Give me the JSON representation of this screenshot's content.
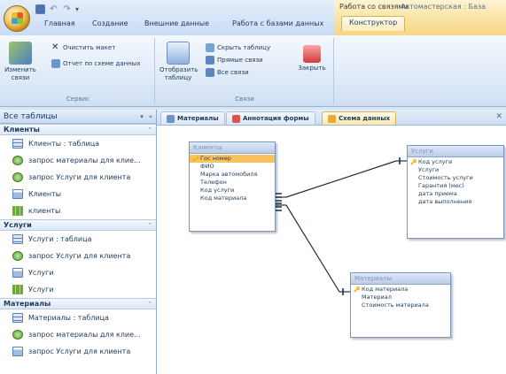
{
  "titlebar": {
    "context_group": "Работа со связями",
    "app_title": "Автомастерская : База",
    "tabs": [
      "Главная",
      "Создание",
      "Внешние данные",
      "Работа с базами данных",
      "Конструктор"
    ],
    "active_tab": "Конструктор"
  },
  "ribbon": {
    "service": {
      "label": "Сервис",
      "edit_links": "Изменить связи",
      "clear_layout": "Очистить макет",
      "schema_report": "Отчет по схеме данных"
    },
    "links": {
      "label": "Связи",
      "show_table": "Отобразить таблицу",
      "hide_table": "Скрыть таблицу",
      "direct_links": "Прямые связи",
      "all_links": "Все связи",
      "close": "Закрыть"
    }
  },
  "nav": {
    "title": "Все таблицы",
    "groups": [
      {
        "name": "Клиенты",
        "items": [
          {
            "icon": "table",
            "label": "Клиенты : таблица"
          },
          {
            "icon": "query",
            "label": "запрос материалы для клие..."
          },
          {
            "icon": "query",
            "label": "запрос Услуги для клиента"
          },
          {
            "icon": "form",
            "label": "Клиенты"
          },
          {
            "icon": "report",
            "label": "клиенты"
          }
        ]
      },
      {
        "name": "Услуги",
        "items": [
          {
            "icon": "table",
            "label": "Услуги : таблица"
          },
          {
            "icon": "query",
            "label": "запрос Услуги для клиента"
          },
          {
            "icon": "form",
            "label": "Услуги"
          },
          {
            "icon": "report",
            "label": "Услуги"
          }
        ]
      },
      {
        "name": "Материалы",
        "items": [
          {
            "icon": "table",
            "label": "Материалы : таблица"
          },
          {
            "icon": "query",
            "label": "запрос материалы для клие..."
          },
          {
            "icon": "form",
            "label": "запрос Услуги для клиента"
          }
        ]
      }
    ]
  },
  "doc_tabs": [
    "Материалы",
    "Аннотация формы",
    "Схема данных"
  ],
  "active_doc_tab": "Схема данных",
  "schema": {
    "tables": [
      {
        "name": "Клиенты",
        "fields": [
          "Гос номер",
          "ФИО",
          "Марка автомобиля",
          "Телефон",
          "Код услуги",
          "Код материала"
        ],
        "key": "Гос номер",
        "selected": "Гос номер"
      },
      {
        "name": "Услуги",
        "fields": [
          "Код услуги",
          "Услуги",
          "Стоимость услуги",
          "Гарантия (мес)",
          "дата приема",
          "дата выполнения"
        ],
        "key": "Код услуги",
        "selected": null
      },
      {
        "name": "Материалы",
        "fields": [
          "Код материала",
          "Материал",
          "Стоимость материала"
        ],
        "key": "Код материала",
        "selected": null
      }
    ],
    "relationships": [
      {
        "from": "Клиенты.Код услуги",
        "to": "Услуги.Код услуги",
        "one": "1",
        "many": "∞"
      },
      {
        "from": "Клиенты.Код материала",
        "to": "Материалы.Код материала",
        "one": "1",
        "many": "∞"
      }
    ]
  },
  "colors": {
    "selected_field": "#f6c35c",
    "ribbon_ctx": "#f9e3a2",
    "accent": "#1e395b"
  }
}
